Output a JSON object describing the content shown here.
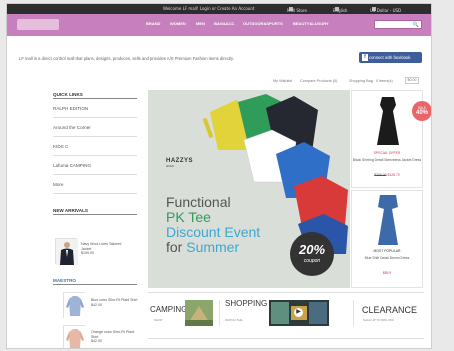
{
  "topbar": {
    "welcome": "Welcome LF mall! Login or Create An Account",
    "store": "Mall Store",
    "language": "English",
    "currency": "US Dollar - USD"
  },
  "nav": {
    "items": [
      "BRAND",
      "WOMEN",
      "MEN",
      "BAG&ACC",
      "OUTDOOR&SPORTS",
      "BEAUTY&LUXURY"
    ]
  },
  "header": {
    "tagline": "LF mall is a direct control mall that plans, designs, produces, sells and provides A/S Premium Fashion items directly.",
    "facebook_label": "connect with facebook"
  },
  "utility": {
    "my_wishlist": "My Wishlist",
    "compare": "Compare Products (0)",
    "shopping_bag": "Shopping Bag",
    "items": "0 items(s)",
    "total": "$0.00"
  },
  "sidebar": {
    "quick_links_title": "QUICK LINKS",
    "quick_links": [
      "RALPH EDITION",
      "Around the Corner",
      "KIDS C",
      "Lafuma CAMPING",
      "More"
    ],
    "new_arrivals_title": "NEW ARRIVALS",
    "new_arrivals": [
      {
        "name": "Navy Wool Lines Tailored Jacket",
        "price": "$199.00"
      }
    ],
    "maestro_title": "MAESTRO",
    "maestro": [
      {
        "name": "Blue color Slim-Fit Plaid Shirt",
        "price": "$42.00"
      },
      {
        "name": "Orange color Slim-Fit Plaid Shirt",
        "price": "$42.00"
      }
    ]
  },
  "banner": {
    "brand": "HAZZYS",
    "brand_sub": "GOLF",
    "line1": "Functional",
    "line2a": "PK Tee",
    "line2b": "Discount Event",
    "line3a": "for ",
    "line3b": "Summer",
    "badge_pct": "20%",
    "badge_sub": "coupon"
  },
  "right": {
    "sale_label": "SALE",
    "sale_pct": "40%",
    "special_offer": "SPECIAL OFFER",
    "product1": "Black Shirring Detail Sleeveless Jacket Dress",
    "old_price": "$305.00",
    "new_price": "$128.70",
    "most_popular": "MOST POPULAR",
    "product2": "Blue Shift Detail Denim Dress",
    "price2": "$89.9"
  },
  "promos": {
    "camping": "CAMPING",
    "camping_sub": "SHOP",
    "shopping_tv": "SHOPPING TV",
    "shopping_tv_sub": "WATCH THE",
    "clearance": "CLEARANCE",
    "clearance_sub": "SALE UP TO 80% OFF"
  },
  "colors": {
    "nav_purple": "#c77fbd",
    "topbar": "#2d2d2d",
    "facebook": "#3f5d9a",
    "accent_green": "#2f9c5a",
    "accent_blue": "#3da7d1",
    "sale_red": "#d0364d"
  },
  "icons": [
    "search-icon",
    "facebook-icon",
    "play-icon",
    "chevron-down-icon"
  ]
}
